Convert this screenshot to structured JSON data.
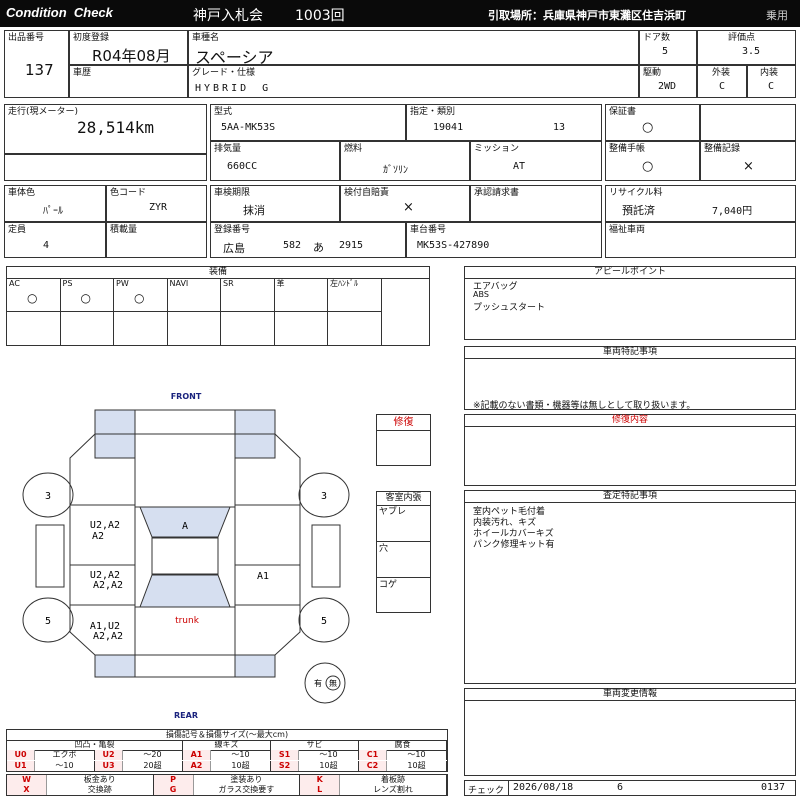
{
  "header": {
    "title_left": "Condition  Check",
    "auction": "神戸入札会",
    "session": "1003回",
    "pickup": "引取場所：兵庫県神戸市東灘区住吉浜町",
    "category": "乗用"
  },
  "vehicle": {
    "lot_label": "出品番号",
    "lot": "137",
    "first_reg_label": "初度登録",
    "first_reg": "R04年08月",
    "name_label": "車種名",
    "name": "スペーシア",
    "history_label": "車歴",
    "grade_label": "グレード・仕様",
    "grade": "HYBRID　G",
    "doors_label": "ドア数",
    "doors": "5",
    "score_label": "評価点",
    "score": "3.5",
    "drive_label": "駆動",
    "drive": "2WD",
    "exterior_label": "外装",
    "exterior": "C",
    "interior_label": "内装",
    "interior": "C"
  },
  "specs": {
    "mileage_label": "走行(現メーター)",
    "mileage": "28,514km",
    "model_label": "型式",
    "model": "5AA-MK53S",
    "designation_label": "指定・類別",
    "designation": "19041",
    "category_no": "13",
    "warranty_label": "保証書",
    "warranty": "○",
    "displacement_label": "排気量",
    "displacement": "660CC",
    "fuel_label": "燃料",
    "fuel": "ｶﾞｿﾘﾝ",
    "mission_label": "ミッション",
    "mission": "AT",
    "manual_label": "整備手帳",
    "manual": "○",
    "maintenance_label": "整備記録",
    "maintenance": "×",
    "color_label": "車体色",
    "color": "ﾊﾟｰﾙ",
    "color_code_label": "色コード",
    "color_code": "ZYR",
    "inspection_label": "車検期限",
    "inspection": "抹消",
    "insurance_label": "検付自賠責",
    "insurance": "×",
    "approval_label": "承認請求書",
    "recycle_label": "リサイクル料",
    "recycle_status": "預託済",
    "recycle_fee": "7,040円",
    "capacity_label": "定員",
    "capacity": "4",
    "load_label": "積載量",
    "plate_label": "登録番号",
    "plate_region": "広島",
    "plate_class": "582",
    "plate_kana": "あ",
    "plate_number": "2915",
    "chassis_label": "車台番号",
    "chassis": "MK53S-427890",
    "welfare_label": "福祉車両"
  },
  "equipment": {
    "title": "装備",
    "cols": [
      {
        "label": "AC",
        "value": "○"
      },
      {
        "label": "PS",
        "value": "○"
      },
      {
        "label": "PW",
        "value": "○"
      },
      {
        "label": "NAVI",
        "value": ""
      },
      {
        "label": "SR",
        "value": ""
      },
      {
        "label": "革",
        "value": ""
      },
      {
        "label": "左ﾊﾝﾄﾞﾙ",
        "value": ""
      }
    ]
  },
  "appeal": {
    "title": "アピールポイント",
    "lines": [
      "エアバッグ",
      "ABS",
      "プッシュスタート"
    ]
  },
  "special": {
    "title": "車両特記事項",
    "note": "※記載のない書類・機器等は無しとして取り扱います。"
  },
  "repair": {
    "label": "修復",
    "content_label": "修復内容"
  },
  "interior_box": {
    "title": "客室内張",
    "items": [
      "ヤブレ",
      "穴",
      "コゲ"
    ]
  },
  "inspection_notes": {
    "title": "査定特記事項",
    "lines": [
      "室内ペット毛付着",
      "内装汚れ、キズ",
      "ホイールカバーキズ",
      "パンク修理キット有"
    ]
  },
  "change_info": {
    "title": "車両変更情報"
  },
  "diagram": {
    "front": "FRONT",
    "rear": "REAR",
    "tire_fl": "3",
    "tire_fr": "3",
    "tire_rl": "5",
    "tire_rr": "5",
    "left_front_door": "U2,A2\nA2",
    "left_rear_door": "U2,A2\nA2,A2",
    "left_rear_quarter": "A1,U2\nA2,A2",
    "windshield": "A",
    "right_rear_door": "A1",
    "trunk": "trunk",
    "stamp_prefix": "有",
    "stamp": "無"
  },
  "legend": {
    "title": "損傷記号＆損傷サイズ(～最大cm)",
    "groups": [
      "凹凸・亀裂",
      "線キズ",
      "サビ",
      "腐食"
    ],
    "rows": [
      [
        {
          "code": "U0",
          "desc": "エクボ"
        },
        {
          "code": "U2",
          "desc": "～20"
        },
        {
          "code": "A1",
          "desc": "～10"
        },
        {
          "code": "S1",
          "desc": "～10"
        },
        {
          "code": "C1",
          "desc": "～10"
        }
      ],
      [
        {
          "code": "U1",
          "desc": "～10"
        },
        {
          "code": "U3",
          "desc": "20超"
        },
        {
          "code": "A2",
          "desc": "10超"
        },
        {
          "code": "S2",
          "desc": "10超"
        },
        {
          "code": "C2",
          "desc": "10超"
        }
      ]
    ],
    "symbols": [
      [
        {
          "code": "W",
          "desc": "板金あり"
        },
        {
          "code": "P",
          "desc": "塗装あり"
        },
        {
          "code": "K",
          "desc": "着板跡"
        }
      ],
      [
        {
          "code": "X",
          "desc": "交換跡"
        },
        {
          "code": "G",
          "desc": "ガラス交換要す"
        },
        {
          "code": "L",
          "desc": "レンズ割れ"
        }
      ]
    ]
  },
  "check": {
    "label": "チェック",
    "date": "2026/08/18",
    "number": "6",
    "code": "0137"
  }
}
